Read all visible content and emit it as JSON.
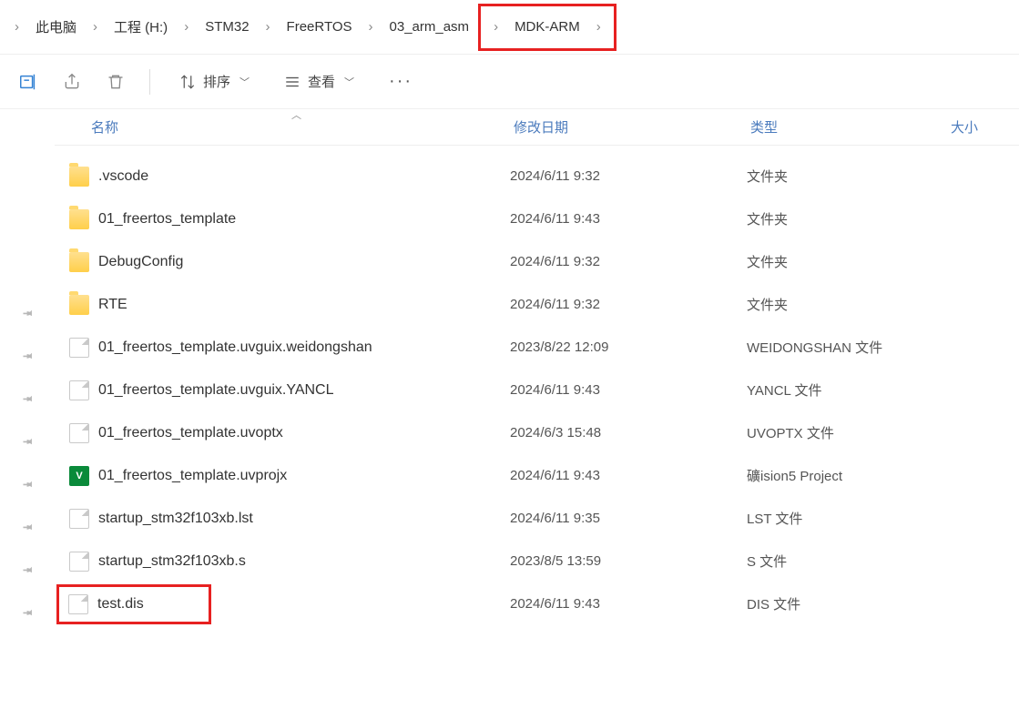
{
  "breadcrumb": {
    "items": [
      "此电脑",
      "工程 (H:)",
      "STM32",
      "FreeRTOS",
      "03_arm_asm",
      "MDK-ARM"
    ]
  },
  "toolbar": {
    "sort_label": "排序",
    "view_label": "查看"
  },
  "headers": {
    "name": "名称",
    "date": "修改日期",
    "type": "类型",
    "size": "大小"
  },
  "rows": [
    {
      "icon": "folder",
      "name": ".vscode",
      "date": "2024/6/11 9:32",
      "type": "文件夹"
    },
    {
      "icon": "folder",
      "name": "01_freertos_template",
      "date": "2024/6/11 9:43",
      "type": "文件夹"
    },
    {
      "icon": "folder",
      "name": "DebugConfig",
      "date": "2024/6/11 9:32",
      "type": "文件夹"
    },
    {
      "icon": "folder",
      "name": "RTE",
      "date": "2024/6/11 9:32",
      "type": "文件夹"
    },
    {
      "icon": "file",
      "name": "01_freertos_template.uvguix.weidongshan",
      "date": "2023/8/22 12:09",
      "type": "WEIDONGSHAN 文件"
    },
    {
      "icon": "file",
      "name": "01_freertos_template.uvguix.YANCL",
      "date": "2024/6/11 9:43",
      "type": "YANCL 文件"
    },
    {
      "icon": "file",
      "name": "01_freertos_template.uvoptx",
      "date": "2024/6/3 15:48",
      "type": "UVOPTX 文件"
    },
    {
      "icon": "project",
      "name": "01_freertos_template.uvprojx",
      "date": "2024/6/11 9:43",
      "type": "礦ision5 Project"
    },
    {
      "icon": "file",
      "name": "startup_stm32f103xb.lst",
      "date": "2024/6/11 9:35",
      "type": "LST 文件"
    },
    {
      "icon": "file",
      "name": "startup_stm32f103xb.s",
      "date": "2023/8/5 13:59",
      "type": "S 文件"
    },
    {
      "icon": "file",
      "name": "test.dis",
      "date": "2024/6/11 9:43",
      "type": "DIS 文件",
      "highlight": true
    }
  ]
}
